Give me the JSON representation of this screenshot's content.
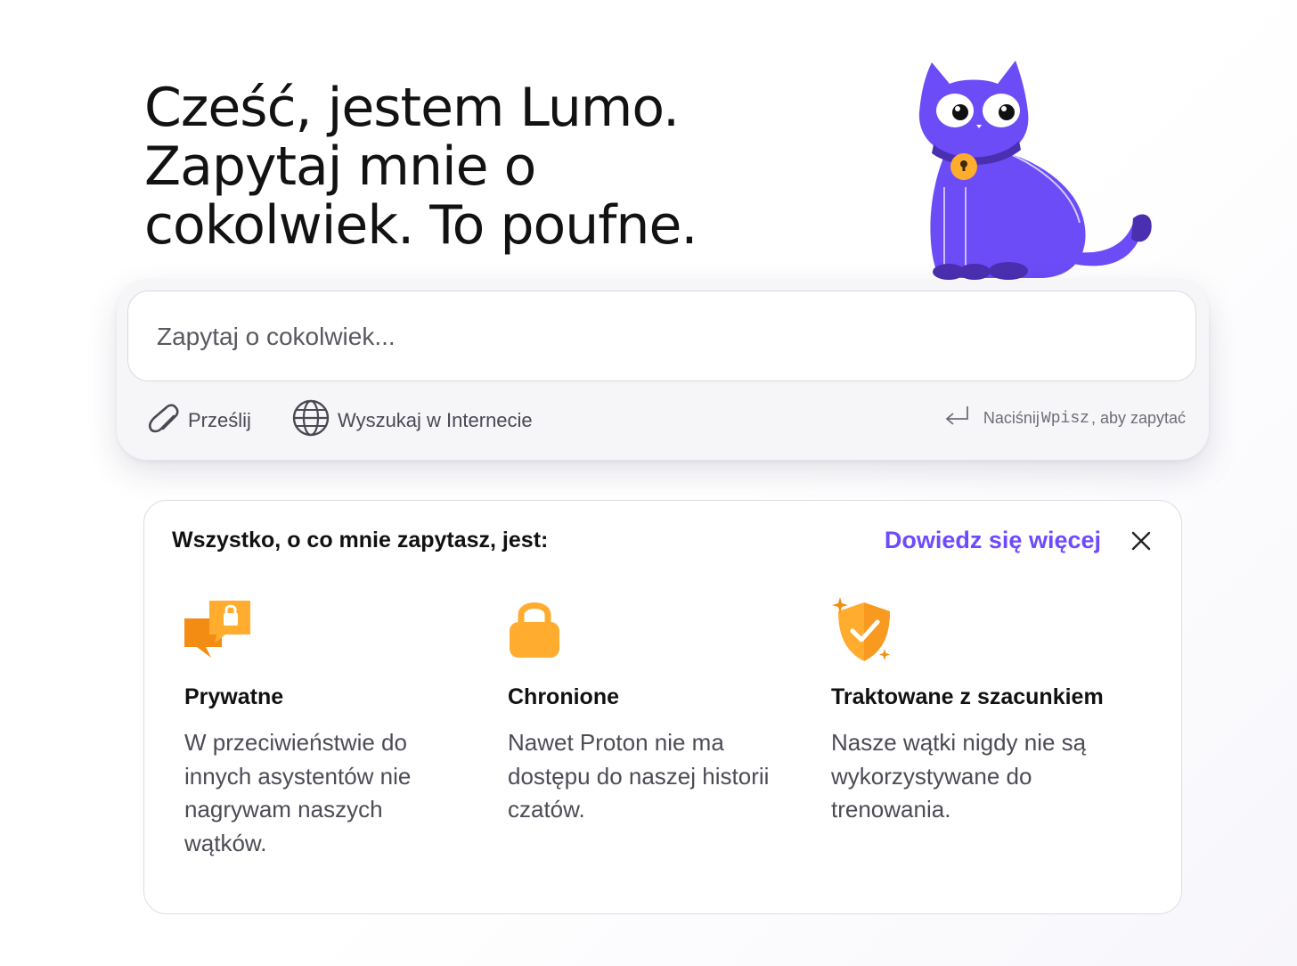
{
  "hero": {
    "line1": "Cześć, jestem Lumo.",
    "line2": "Zapytaj mnie o",
    "line3": "cokolwiek. To poufne.",
    "mascot_icon": "lumo-cat-mascot"
  },
  "composer": {
    "placeholder": "Zapytaj o cokolwiek...",
    "upload_label": "Prześlij",
    "upload_icon": "paperclip-icon",
    "web_search_label": "Wyszukaj w Internecie",
    "web_search_icon": "globe-icon",
    "hint_prefix": "Naciśnij ",
    "hint_key": "Wpisz",
    "hint_suffix": ", aby zapytać",
    "hint_icon": "enter-key-icon"
  },
  "info": {
    "heading": "Wszystko, o co mnie zapytasz, jest:",
    "learn_more": "Dowiedz się więcej",
    "close_icon": "close-icon",
    "features": [
      {
        "icon": "chat-lock-icon",
        "title": "Prywatne",
        "description": "W przeciwieństwie do innych asystentów nie nagrywam naszych wątków."
      },
      {
        "icon": "padlock-icon",
        "title": "Chronione",
        "description": "Nawet Proton nie ma dostępu do naszej historii czatów."
      },
      {
        "icon": "shield-check-icon",
        "title": "Traktowane z szacunkiem",
        "description": "Nasze wątki nigdy nie są wykorzystywane do trenowania."
      }
    ]
  },
  "colors": {
    "accent": "#6d4aff",
    "mascot": "#6b4cf6",
    "icon_orange": "#ffac2f",
    "icon_orange_dark": "#f38c12"
  }
}
